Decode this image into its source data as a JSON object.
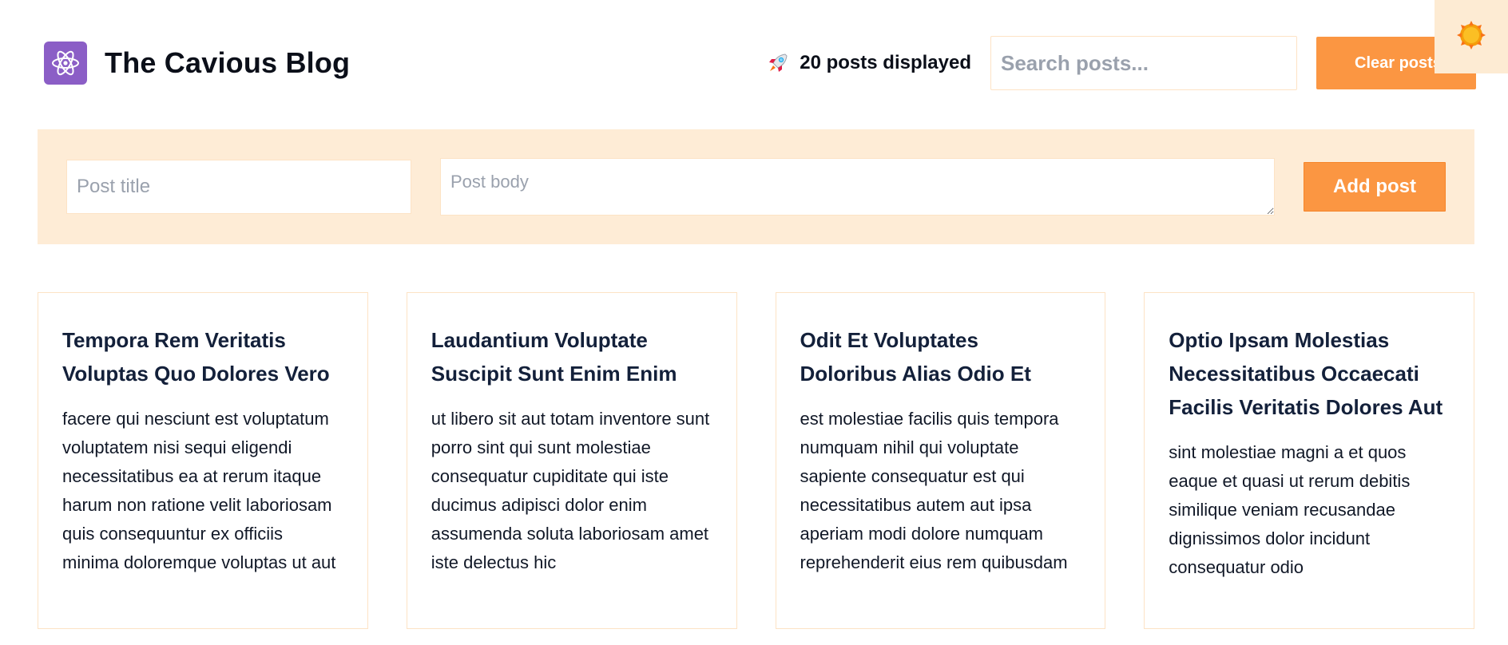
{
  "header": {
    "title": "The Cavious Blog",
    "count_text": "20 posts displayed",
    "search_placeholder": "Search posts...",
    "clear_label": "Clear posts"
  },
  "form": {
    "title_placeholder": "Post title",
    "body_placeholder": "Post body",
    "add_label": "Add post"
  },
  "posts": [
    {
      "title": "Tempora Rem Veritatis Voluptas Quo Dolores Vero",
      "body": "facere qui nesciunt est voluptatum voluptatem nisi sequi eligendi necessitatibus ea at rerum itaque harum non ratione velit laboriosam quis consequuntur ex officiis minima doloremque voluptas ut aut"
    },
    {
      "title": "Laudantium Voluptate Suscipit Sunt Enim Enim",
      "body": "ut libero sit aut totam inventore sunt porro sint qui sunt molestiae consequatur cupiditate qui iste ducimus adipisci dolor enim assumenda soluta laboriosam amet iste delectus hic"
    },
    {
      "title": "Odit Et Voluptates Doloribus Alias Odio Et",
      "body": "est molestiae facilis quis tempora numquam nihil qui voluptate sapiente consequatur est qui necessitatibus autem aut ipsa aperiam modi dolore numquam reprehenderit eius rem quibusdam"
    },
    {
      "title": "Optio Ipsam Molestias Necessitatibus Occaecati Facilis Veritatis Dolores Aut",
      "body": "sint molestiae magni a et quos eaque et quasi ut rerum debitis similique veniam recusandae dignissimos dolor incidunt consequatur odio"
    }
  ],
  "icons": {
    "logo": "atom-icon",
    "count": "rocket-icon",
    "theme": "sun-icon"
  },
  "colors": {
    "accent": "#fb9642",
    "form_background": "#feecd6",
    "logo_background": "#8b5ec6",
    "card_border": "#fde3c5"
  }
}
